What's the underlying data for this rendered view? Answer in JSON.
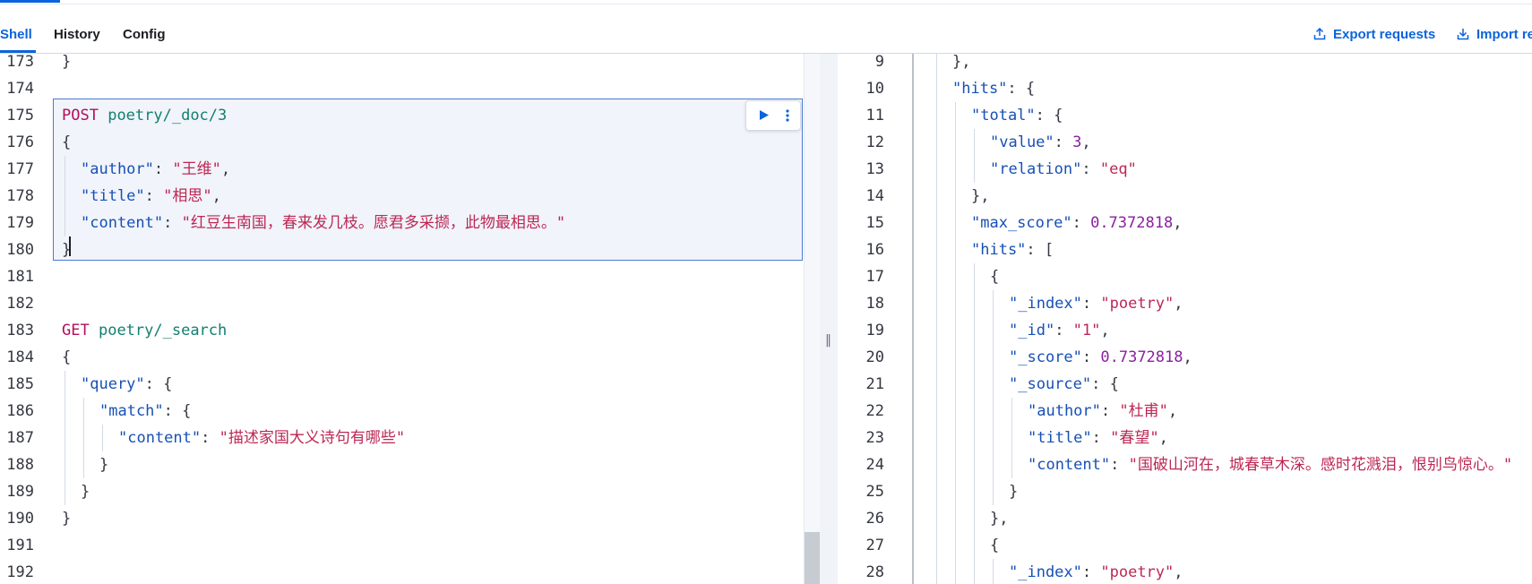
{
  "tabs": [
    {
      "label": "Shell",
      "active": true
    },
    {
      "label": "History",
      "active": false
    },
    {
      "label": "Config",
      "active": false
    }
  ],
  "header_actions": {
    "export_label": "Export requests",
    "import_label": "Import re"
  },
  "editor": {
    "lines": [
      {
        "n": "173",
        "indent": 0,
        "parts": [
          [
            "p",
            "}"
          ]
        ]
      },
      {
        "n": "174",
        "indent": 0,
        "parts": []
      },
      {
        "n": "175",
        "indent": 0,
        "parts": [
          [
            "m",
            "POST"
          ],
          [
            "p",
            " "
          ],
          [
            "u",
            "poetry/_doc/3"
          ]
        ]
      },
      {
        "n": "176",
        "indent": 0,
        "parts": [
          [
            "p",
            "{"
          ]
        ]
      },
      {
        "n": "177",
        "indent": 1,
        "parts": [
          [
            "k",
            "\"author\""
          ],
          [
            "p",
            ": "
          ],
          [
            "s",
            "\"王维\""
          ],
          [
            "p",
            ","
          ]
        ]
      },
      {
        "n": "178",
        "indent": 1,
        "parts": [
          [
            "k",
            "\"title\""
          ],
          [
            "p",
            ": "
          ],
          [
            "s",
            "\"相思\""
          ],
          [
            "p",
            ","
          ]
        ]
      },
      {
        "n": "179",
        "indent": 1,
        "parts": [
          [
            "k",
            "\"content\""
          ],
          [
            "p",
            ": "
          ],
          [
            "s",
            "\"红豆生南国，春来发几枝。愿君多采撷，此物最相思。\""
          ]
        ]
      },
      {
        "n": "180",
        "indent": 0,
        "parts": [
          [
            "p",
            "}"
          ]
        ]
      },
      {
        "n": "181",
        "indent": 0,
        "parts": []
      },
      {
        "n": "182",
        "indent": 0,
        "parts": []
      },
      {
        "n": "183",
        "indent": 0,
        "parts": [
          [
            "m",
            "GET"
          ],
          [
            "p",
            " "
          ],
          [
            "u",
            "poetry/_search"
          ]
        ]
      },
      {
        "n": "184",
        "indent": 0,
        "parts": [
          [
            "p",
            "{"
          ]
        ]
      },
      {
        "n": "185",
        "indent": 1,
        "parts": [
          [
            "k",
            "\"query\""
          ],
          [
            "p",
            ": {"
          ]
        ]
      },
      {
        "n": "186",
        "indent": 2,
        "parts": [
          [
            "k",
            "\"match\""
          ],
          [
            "p",
            ": {"
          ]
        ]
      },
      {
        "n": "187",
        "indent": 3,
        "parts": [
          [
            "k",
            "\"content\""
          ],
          [
            "p",
            ": "
          ],
          [
            "s",
            "\"描述家国大义诗句有哪些\""
          ]
        ]
      },
      {
        "n": "188",
        "indent": 2,
        "parts": [
          [
            "p",
            "}"
          ]
        ]
      },
      {
        "n": "189",
        "indent": 1,
        "parts": [
          [
            "p",
            "}"
          ]
        ]
      },
      {
        "n": "190",
        "indent": 0,
        "parts": [
          [
            "p",
            "}"
          ]
        ]
      },
      {
        "n": "191",
        "indent": 0,
        "parts": []
      },
      {
        "n": "192",
        "indent": 0,
        "parts": []
      }
    ]
  },
  "output": {
    "lines": [
      {
        "n": "9",
        "indent": 1,
        "parts": [
          [
            "p",
            "},"
          ]
        ]
      },
      {
        "n": "10",
        "indent": 1,
        "parts": [
          [
            "k",
            "\"hits\""
          ],
          [
            "p",
            ": {"
          ]
        ]
      },
      {
        "n": "11",
        "indent": 2,
        "parts": [
          [
            "k",
            "\"total\""
          ],
          [
            "p",
            ": {"
          ]
        ]
      },
      {
        "n": "12",
        "indent": 3,
        "parts": [
          [
            "k",
            "\"value\""
          ],
          [
            "p",
            ": "
          ],
          [
            "n",
            "3"
          ],
          [
            "p",
            ","
          ]
        ]
      },
      {
        "n": "13",
        "indent": 3,
        "parts": [
          [
            "k",
            "\"relation\""
          ],
          [
            "p",
            ": "
          ],
          [
            "s",
            "\"eq\""
          ]
        ]
      },
      {
        "n": "14",
        "indent": 2,
        "parts": [
          [
            "p",
            "},"
          ]
        ]
      },
      {
        "n": "15",
        "indent": 2,
        "parts": [
          [
            "k",
            "\"max_score\""
          ],
          [
            "p",
            ": "
          ],
          [
            "n",
            "0.7372818"
          ],
          [
            "p",
            ","
          ]
        ]
      },
      {
        "n": "16",
        "indent": 2,
        "parts": [
          [
            "k",
            "\"hits\""
          ],
          [
            "p",
            ": ["
          ]
        ]
      },
      {
        "n": "17",
        "indent": 3,
        "parts": [
          [
            "p",
            "{"
          ]
        ]
      },
      {
        "n": "18",
        "indent": 4,
        "parts": [
          [
            "k",
            "\"_index\""
          ],
          [
            "p",
            ": "
          ],
          [
            "s",
            "\"poetry\""
          ],
          [
            "p",
            ","
          ]
        ]
      },
      {
        "n": "19",
        "indent": 4,
        "parts": [
          [
            "k",
            "\"_id\""
          ],
          [
            "p",
            ": "
          ],
          [
            "s",
            "\"1\""
          ],
          [
            "p",
            ","
          ]
        ]
      },
      {
        "n": "20",
        "indent": 4,
        "parts": [
          [
            "k",
            "\"_score\""
          ],
          [
            "p",
            ": "
          ],
          [
            "n",
            "0.7372818"
          ],
          [
            "p",
            ","
          ]
        ]
      },
      {
        "n": "21",
        "indent": 4,
        "parts": [
          [
            "k",
            "\"_source\""
          ],
          [
            "p",
            ": {"
          ]
        ]
      },
      {
        "n": "22",
        "indent": 5,
        "parts": [
          [
            "k",
            "\"author\""
          ],
          [
            "p",
            ": "
          ],
          [
            "s",
            "\"杜甫\""
          ],
          [
            "p",
            ","
          ]
        ]
      },
      {
        "n": "23",
        "indent": 5,
        "parts": [
          [
            "k",
            "\"title\""
          ],
          [
            "p",
            ": "
          ],
          [
            "s",
            "\"春望\""
          ],
          [
            "p",
            ","
          ]
        ]
      },
      {
        "n": "24",
        "indent": 5,
        "parts": [
          [
            "k",
            "\"content\""
          ],
          [
            "p",
            ": "
          ],
          [
            "s",
            "\"国破山河在，城春草木深。感时花溅泪，恨别鸟惊心。\""
          ]
        ]
      },
      {
        "n": "25",
        "indent": 4,
        "parts": [
          [
            "p",
            "}"
          ]
        ]
      },
      {
        "n": "26",
        "indent": 3,
        "parts": [
          [
            "p",
            "},"
          ]
        ]
      },
      {
        "n": "27",
        "indent": 3,
        "parts": [
          [
            "p",
            "{"
          ]
        ]
      },
      {
        "n": "28",
        "indent": 4,
        "parts": [
          [
            "k",
            "\"_index\""
          ],
          [
            "p",
            ": "
          ],
          [
            "s",
            "\"poetry\""
          ],
          [
            "p",
            ","
          ]
        ]
      }
    ]
  },
  "colors": {
    "accent": "#0b64dd",
    "key": "#1750b5",
    "string": "#bd2754",
    "number": "#8b1fa0",
    "method": "#b30f5a",
    "url": "#127f70"
  },
  "icons": {
    "export": "export-icon",
    "import": "import-icon",
    "run": "play-icon",
    "more": "vertical-dots-icon",
    "resize": "resize-grip-icon"
  }
}
